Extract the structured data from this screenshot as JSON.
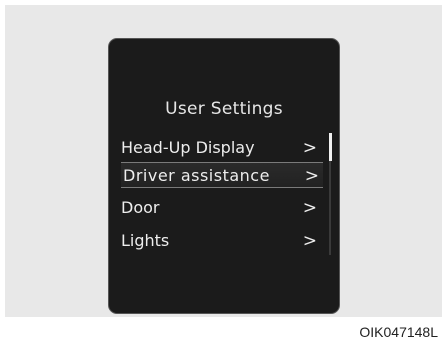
{
  "screen": {
    "title": "User Settings",
    "items": [
      {
        "label": "Head-Up Display",
        "chevron": ">",
        "selected": false
      },
      {
        "label": "Driver assistance",
        "chevron": ">",
        "selected": true
      },
      {
        "label": "Door",
        "chevron": ">",
        "selected": false
      },
      {
        "label": "Lights",
        "chevron": ">",
        "selected": false
      }
    ]
  },
  "image_code": "OIK047148L"
}
